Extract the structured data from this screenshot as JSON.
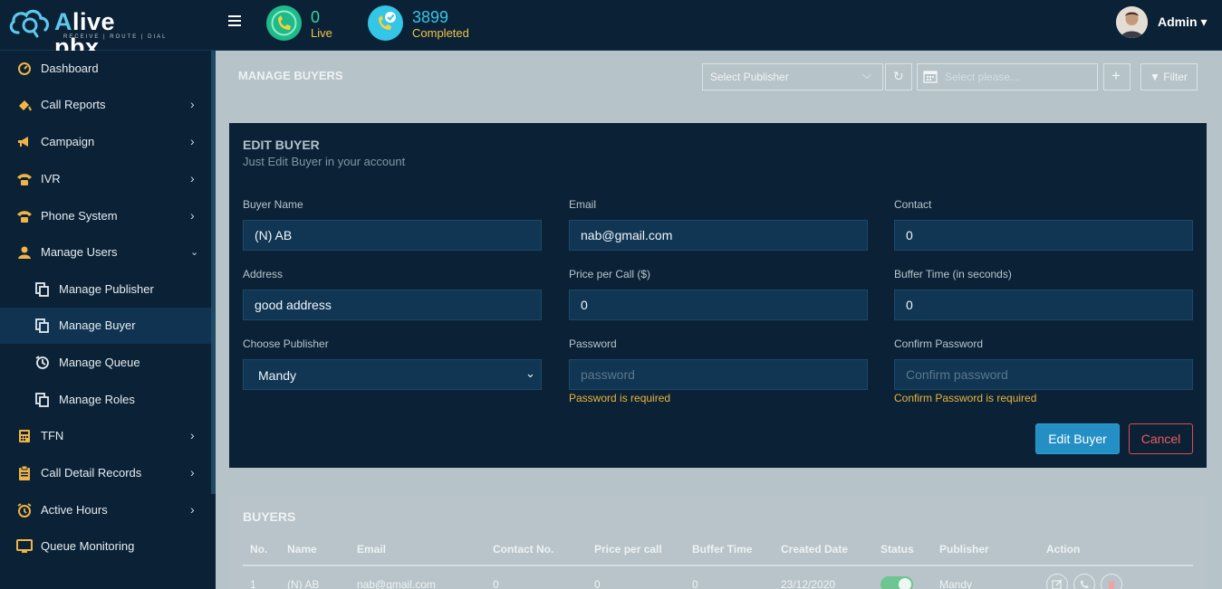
{
  "brand": {
    "name_a": "A",
    "name_rest": "live pbx",
    "tagline": "RECEIVE | ROUTE | DIAL"
  },
  "header": {
    "live": {
      "count": "0",
      "label": "Live"
    },
    "completed": {
      "count": "3899",
      "label": "Completed"
    },
    "user": "Admin"
  },
  "sidebar": {
    "items": [
      {
        "label": "Dashboard",
        "icon": "dashboard-icon"
      },
      {
        "label": "Call Reports",
        "icon": "call-reports-icon"
      },
      {
        "label": "Campaign",
        "icon": "megaphone-icon"
      },
      {
        "label": "IVR",
        "icon": "phone-icon"
      },
      {
        "label": "Phone System",
        "icon": "phone-icon"
      },
      {
        "label": "Manage Users",
        "icon": "user-icon"
      },
      {
        "label": "Manage Publisher",
        "icon": "copy-icon"
      },
      {
        "label": "Manage Buyer",
        "icon": "copy-icon"
      },
      {
        "label": "Manage Queue",
        "icon": "queue-icon"
      },
      {
        "label": "Manage Roles",
        "icon": "copy-icon"
      },
      {
        "label": "TFN",
        "icon": "calculator-icon"
      },
      {
        "label": "Call Detail Records",
        "icon": "clipboard-icon"
      },
      {
        "label": "Active Hours",
        "icon": "clock-icon"
      },
      {
        "label": "Queue Monitoring",
        "icon": "monitor-icon"
      }
    ]
  },
  "page": {
    "title": "MANAGE BUYERS",
    "publisher_select": "Select Publisher",
    "date_placeholder": "Select please...",
    "filter_label": "Filter"
  },
  "form": {
    "title": "EDIT BUYER",
    "subtitle": "Just Edit Buyer in your account",
    "buyer_name": {
      "label": "Buyer Name",
      "value": "(N) AB"
    },
    "email": {
      "label": "Email",
      "value": "nab@gmail.com"
    },
    "contact": {
      "label": "Contact",
      "value": "0"
    },
    "address": {
      "label": "Address",
      "value": "good address"
    },
    "price": {
      "label": "Price per Call ($)",
      "value": "0"
    },
    "buffer": {
      "label": "Buffer Time (in seconds)",
      "value": "0"
    },
    "publisher": {
      "label": "Choose Publisher",
      "value": "Mandy"
    },
    "password": {
      "label": "Password",
      "placeholder": "password",
      "error": "Password is required"
    },
    "confirm": {
      "label": "Confirm Password",
      "placeholder": "Confirm password",
      "error": "Confirm Password is required"
    },
    "submit_label": "Edit Buyer",
    "cancel_label": "Cancel"
  },
  "buyers": {
    "title": "BUYERS",
    "columns": [
      "No.",
      "Name",
      "Email",
      "Contact No.",
      "Price per call",
      "Buffer Time",
      "Created Date",
      "Status",
      "Publisher",
      "Action"
    ],
    "rows": [
      {
        "no": "1",
        "name": "(N) AB",
        "email": "nab@gmail.com",
        "contact": "0",
        "price": "0",
        "buffer": "0",
        "created": "23/12/2020",
        "status_on": true,
        "publisher": "Mandy"
      }
    ]
  },
  "colors": {
    "navy": "#0b2236",
    "accent": "#248fc4",
    "live_green": "#1fb98a",
    "warning": "#e8b43f",
    "danger": "#e04b4b"
  }
}
